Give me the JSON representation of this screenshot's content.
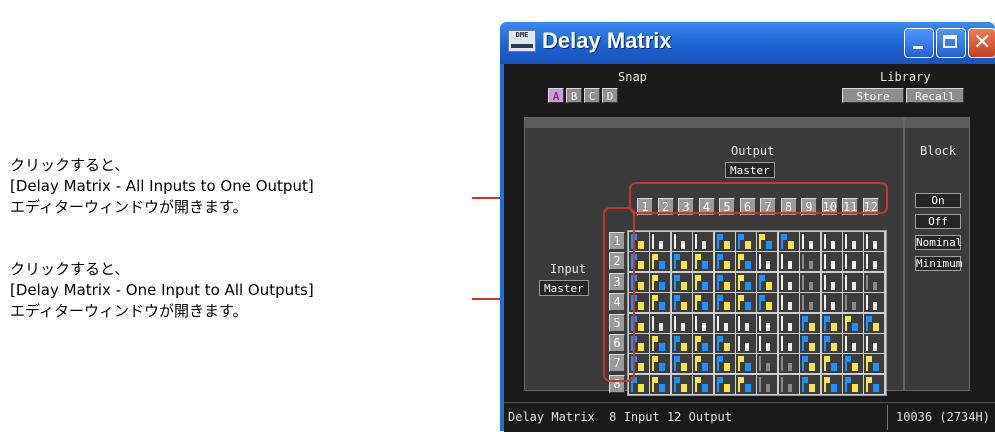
{
  "annotations": [
    {
      "lines": [
        "クリックすると、",
        "[Delay Matrix - All Inputs to One Output]",
        "エディターウィンドウが開きます。"
      ]
    },
    {
      "lines": [
        "クリックすると、",
        "[Delay Matrix - One Input to All Outputs]",
        "エディターウィンドウが開きます。"
      ]
    }
  ],
  "window": {
    "title": "Delay Matrix",
    "icon_label": "DME",
    "controls": [
      "minimize-icon",
      "maximize-icon",
      "close-icon"
    ]
  },
  "snap": {
    "label": "Snap",
    "buttons": [
      "A",
      "B",
      "C",
      "D"
    ],
    "active": "A"
  },
  "library": {
    "label": "Library",
    "store": "Store",
    "recall": "Recall"
  },
  "output": {
    "label": "Output",
    "master": "Master",
    "numbers": [
      "1",
      "2",
      "3",
      "4",
      "5",
      "6",
      "7",
      "8",
      "9",
      "10",
      "11",
      "12"
    ]
  },
  "input": {
    "label": "Input",
    "master": "Master",
    "numbers": [
      "1",
      "2",
      "3",
      "4",
      "5",
      "6",
      "7",
      "8"
    ]
  },
  "block": {
    "label": "Block",
    "buttons": [
      "On",
      "Off",
      "Nominal",
      "Minimum"
    ]
  },
  "matrix": {
    "colors": {
      "blue": "#1e90ff",
      "yellow": "#f2e64a",
      "white": "#f0f0f0",
      "grey": "#8a8a8a"
    },
    "rows": [
      [
        "B",
        "W",
        "W",
        "W",
        "B",
        "B",
        "Y",
        "B",
        "W",
        "W",
        "W",
        "W"
      ],
      [
        "B",
        "Y",
        "B",
        "Y",
        "B",
        "Y",
        "W",
        "W",
        "G",
        "W",
        "W",
        "W"
      ],
      [
        "B",
        "Y",
        "B",
        "Y",
        "B",
        "Y",
        "B",
        "W",
        "G",
        "W",
        "W",
        "G"
      ],
      [
        "B",
        "Y",
        "B",
        "Y",
        "B",
        "Y",
        "B",
        "W",
        "G",
        "W",
        "G",
        "W"
      ],
      [
        "B",
        "W",
        "W",
        "W",
        "W",
        "W",
        "W",
        "W",
        "B",
        "B",
        "Y",
        "B"
      ],
      [
        "B",
        "Y",
        "B",
        "Y",
        "B",
        "W",
        "W",
        "W",
        "B",
        "B",
        "W",
        "W"
      ],
      [
        "B",
        "Y",
        "B",
        "Y",
        "B",
        "Y",
        "G",
        "G",
        "B",
        "Y",
        "B",
        "Y"
      ],
      [
        "B",
        "Y",
        "B",
        "Y",
        "B",
        "Y",
        "G",
        "G",
        "B",
        "Y",
        "B",
        "Y"
      ]
    ]
  },
  "status": {
    "left": "Delay Matrix  8 Input 12 Output",
    "right": "10036 (2734H)"
  },
  "accent": "#c0392b"
}
